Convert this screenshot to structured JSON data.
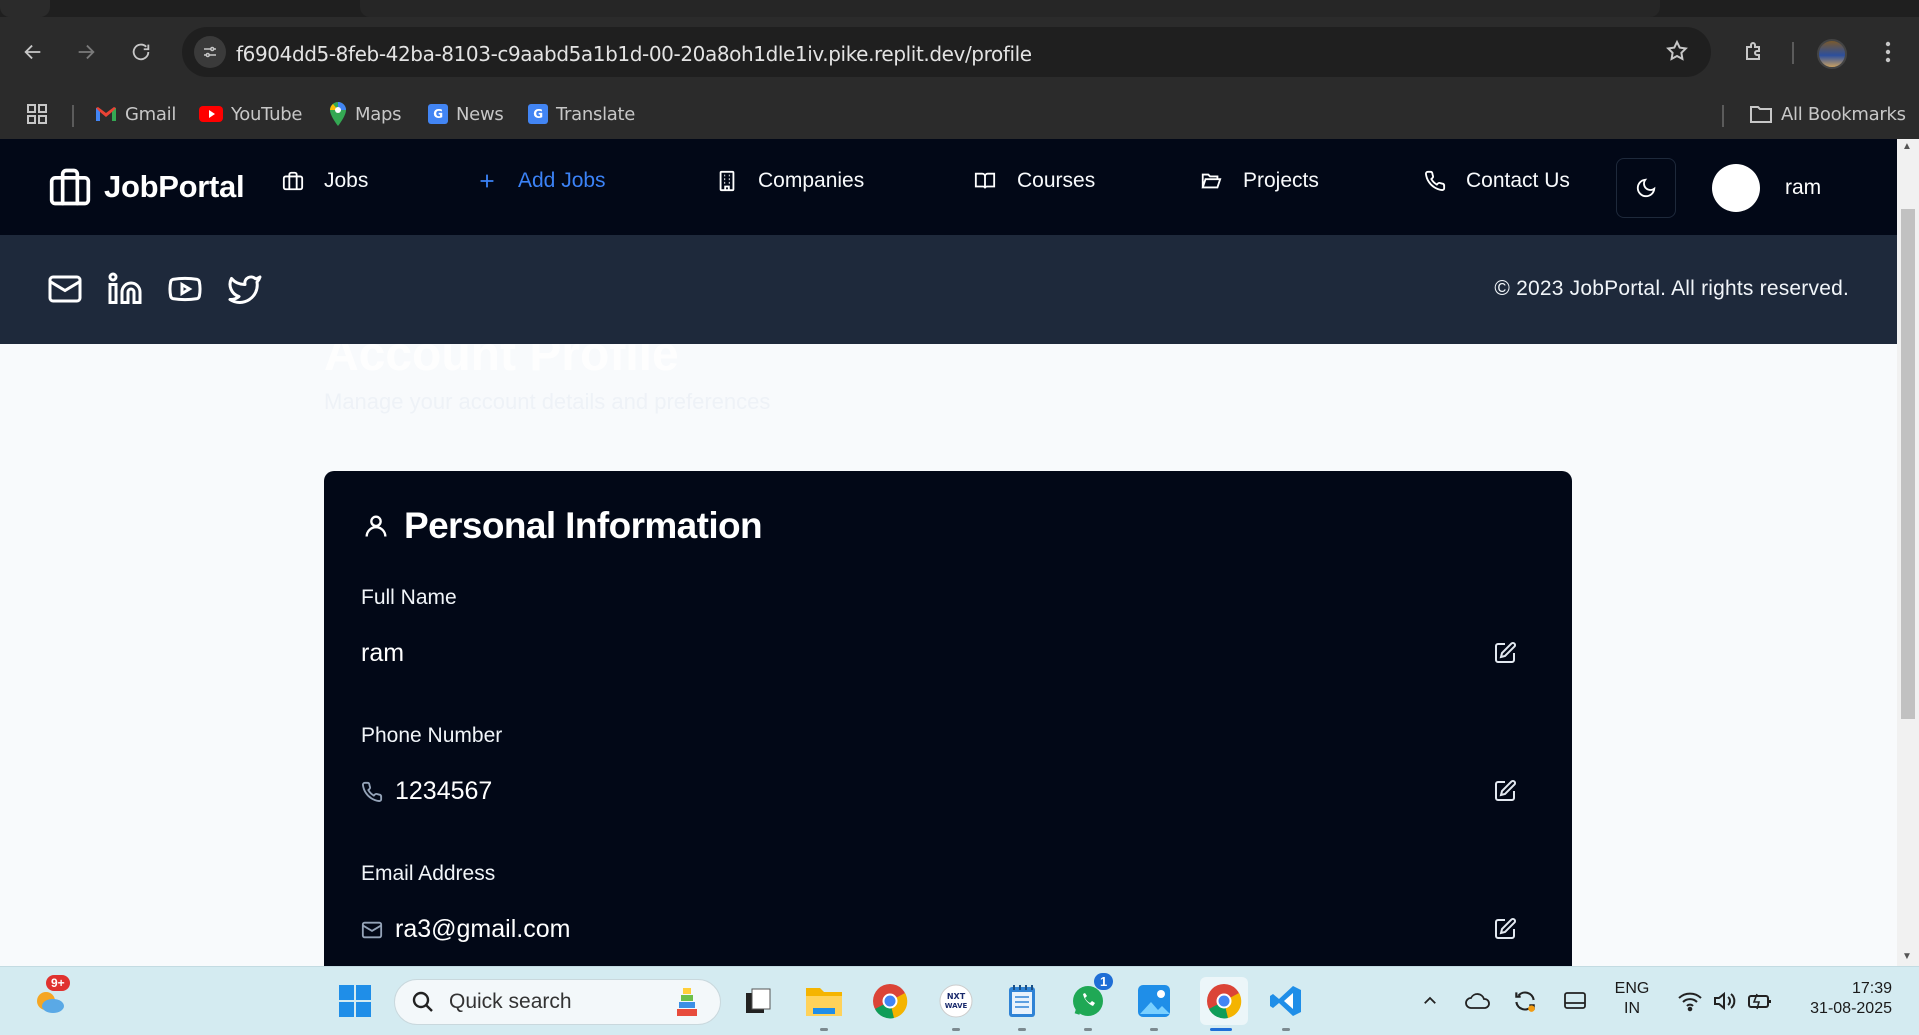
{
  "browser": {
    "url": "f6904dd5-8feb-42ba-8103-c9aabd5a1b1d-00-20a8oh1dle1iv.pike.replit.dev/profile",
    "bookmarks": [
      {
        "label": "Gmail",
        "icon": "gmail-icon",
        "color": "#ea4335"
      },
      {
        "label": "YouTube",
        "icon": "youtube-icon",
        "color": "#ff0000"
      },
      {
        "label": "Maps",
        "icon": "maps-icon",
        "color": "#34a853"
      },
      {
        "label": "News",
        "icon": "news-icon",
        "color": "#4285f4"
      },
      {
        "label": "Translate",
        "icon": "translate-icon",
        "color": "#4285f4"
      }
    ],
    "all_bookmarks": "All Bookmarks"
  },
  "app": {
    "brand": "JobPortal",
    "nav": {
      "jobs": "Jobs",
      "add_jobs": "Add Jobs",
      "companies": "Companies",
      "courses": "Courses",
      "projects": "Projects",
      "contact": "Contact Us"
    },
    "user": "ram",
    "accent": "#3b82f6",
    "copyright": "© 2023 JobPortal. All rights reserved."
  },
  "page": {
    "title": "Account Profile",
    "subtitle": "Manage your account details and preferences"
  },
  "card": {
    "title": "Personal Information",
    "full_name_label": "Full Name",
    "full_name": "ram",
    "phone_label": "Phone Number",
    "phone": "1234567",
    "email_label": "Email Address",
    "email": "ra3@gmail.com"
  },
  "taskbar": {
    "weather_badge": "9+",
    "search_placeholder": "Quick search",
    "whatsapp_badge": "1",
    "lang_top": "ENG",
    "lang_bottom": "IN",
    "time": "17:39",
    "date": "31-08-2025"
  }
}
